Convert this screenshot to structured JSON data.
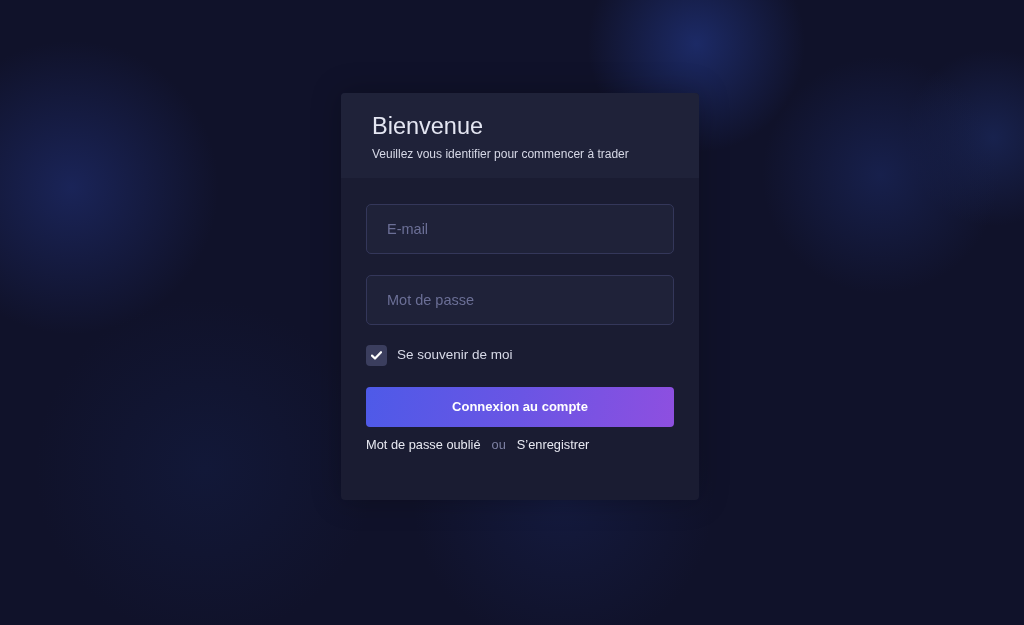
{
  "card": {
    "title": "Bienvenue",
    "subtitle": "Veuillez vous identifier pour commencer à trader"
  },
  "form": {
    "fields": [
      {
        "placeholder": "E-mail"
      },
      {
        "placeholder": "Mot de passe"
      }
    ],
    "remember": {
      "label": "Se souvenir de moi",
      "checked": true
    },
    "submit": "Connexion au compte",
    "links": [
      {
        "kind": "link",
        "text": "Mot de passe oublié"
      },
      {
        "kind": "separator",
        "text": "ou"
      },
      {
        "kind": "link",
        "text": "S’enregistrer"
      }
    ]
  }
}
